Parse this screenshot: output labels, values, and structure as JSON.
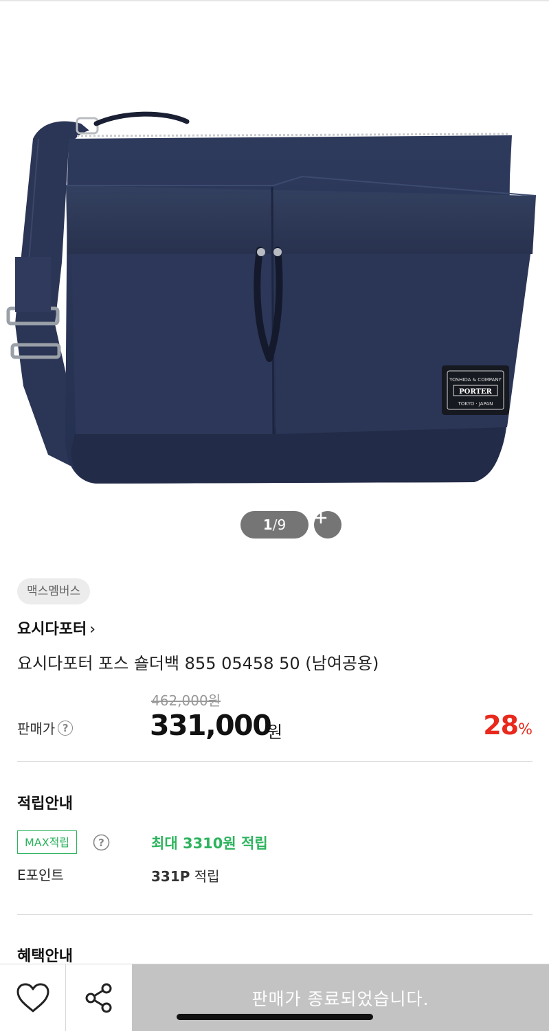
{
  "gallery": {
    "current": "1",
    "separator": "/",
    "total": "9",
    "zoom_icon": "plus-icon",
    "label_line1": "YOSHIDA & COMPANY",
    "label_brand": "PORTER",
    "label_line2": "TOKYO · JAPAN"
  },
  "product": {
    "seller_badge": "맥스멤버스",
    "brand": "요시다포터",
    "brand_chevron": "›",
    "name": "요시다포터 포스 숄더백 855 05458 50 (남여공용)"
  },
  "price": {
    "label": "판매가",
    "original": "462,000원",
    "sale": "331,000",
    "unit": "원",
    "discount": "28",
    "discount_unit": "%",
    "help_icon": "question-icon"
  },
  "points": {
    "title": "적립안내",
    "max_label": "MAX적립",
    "max_value": "최대 3310원 적립",
    "epoint_label": "E포인트",
    "epoint_amount": "331P",
    "epoint_suffix": " 적립",
    "accent_color": "#2db35d"
  },
  "benefits": {
    "title": "혜택안내"
  },
  "bottom_bar": {
    "wish_icon": "heart-icon",
    "share_icon": "share-icon",
    "soldout_label": "판매가 종료되었습니다."
  },
  "colors": {
    "discount": "#e8291c",
    "soldout_bg": "#c3c3c3",
    "pill_bg": "#757575"
  }
}
